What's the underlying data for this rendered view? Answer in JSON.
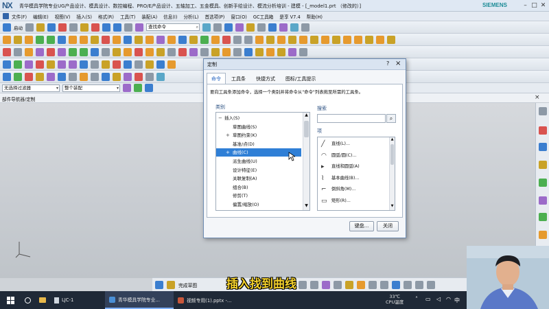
{
  "app": {
    "logo": "NX",
    "title": "青华模具学院专业UG产品设计、模具设计、数控编程、PRO/E产品设计、五轴加工、五金模具、创新手绘设计、模流分析培训 - 建模 - [_model1.prt （修改的）]",
    "brand": "SIEMENS"
  },
  "menubar": {
    "items": [
      "文件(F)",
      "编辑(E)",
      "视图(V)",
      "插入(S)",
      "格式(R)",
      "工具(T)",
      "装配(A)",
      "信息(I)",
      "分析(L)",
      "首选项(P)",
      "窗口(O)",
      "GC工具箱",
      "是享 V7.4",
      "帮助(H)"
    ]
  },
  "toolbar": {
    "start_label": "启动",
    "command_search_placeholder": "查找命令"
  },
  "filterbar": {
    "filter": "无选择过滤器",
    "assembly": "整个装配"
  },
  "nav": {
    "title": "部件导航器/定制"
  },
  "dialog": {
    "title": "定制",
    "help": "?",
    "tabs": [
      "命令",
      "工具条",
      "快捷方式",
      "图标/工具提示"
    ],
    "active_tab": 0,
    "instruction": "要向工具条添加命令，选择一个类别并将命令从\"命令\"列表拖至所需的工具条。",
    "category_label": "类别",
    "categories": [
      {
        "label": "插入(S)",
        "expander": "−",
        "level": 0,
        "selected": false
      },
      {
        "label": "草图曲线(S)",
        "expander": "",
        "level": 1,
        "selected": false
      },
      {
        "label": "草图约束(K)",
        "expander": "+",
        "level": 1,
        "selected": false
      },
      {
        "label": "基准/点(D)",
        "expander": "",
        "level": 1,
        "selected": false
      },
      {
        "label": "曲线(C)",
        "expander": "+",
        "level": 1,
        "selected": true
      },
      {
        "label": "派生曲线(U)",
        "expander": "",
        "level": 1,
        "selected": false
      },
      {
        "label": "设计特征(E)",
        "expander": "",
        "level": 1,
        "selected": false
      },
      {
        "label": "关联复制(A)",
        "expander": "",
        "level": 1,
        "selected": false
      },
      {
        "label": "组合(B)",
        "expander": "",
        "level": 1,
        "selected": false
      },
      {
        "label": "修剪(T)",
        "expander": "",
        "level": 1,
        "selected": false
      },
      {
        "label": "偏置/缩放(O)",
        "expander": "",
        "level": 1,
        "selected": false
      }
    ],
    "search_label": "搜索",
    "search_value": "",
    "items_label": "项",
    "items": [
      {
        "label": "直线(L)...",
        "icon": "line-icon",
        "glyph": "╱"
      },
      {
        "label": "圆弧/圆(C)...",
        "icon": "arc-icon",
        "glyph": "◠"
      },
      {
        "label": "直线和圆弧(A)",
        "icon": "submenu-arrow-icon",
        "glyph": "▸"
      },
      {
        "label": "基本曲线(B)...",
        "icon": "basic-curve-icon",
        "glyph": "⌇"
      },
      {
        "label": "倒斜角(M)...",
        "icon": "chamfer-icon",
        "glyph": "⌐"
      },
      {
        "label": "矩形(R)...",
        "icon": "rectangle-icon",
        "glyph": "▭"
      }
    ],
    "keyboard_button": "键盘...",
    "close_button": "关闭"
  },
  "bottom_toolbar": {
    "finish_sketch": "完成草图"
  },
  "subtitle": "插入找到曲线",
  "taskbar": {
    "apps": [
      "LJC-1",
      "青华模具学院专业...",
      "视频专用(1).pptx -..."
    ],
    "weather": "33℃",
    "cpu": "CPU温度",
    "ime": "中"
  },
  "colors": {
    "selection": "#2f7fd6",
    "subtitle": "#f5d22c",
    "siemens": "#1b8b96"
  }
}
